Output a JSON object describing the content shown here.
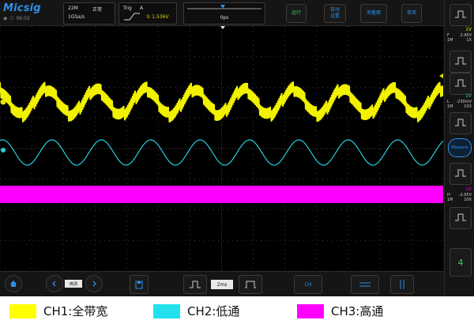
{
  "brand": "Micsig",
  "status": {
    "time": "06:02"
  },
  "acquisition": {
    "memory": "22M",
    "mode": "正常",
    "sample_rate": "1GSa/s"
  },
  "trigger": {
    "label": "Trig",
    "source": "A",
    "level": "1.536V"
  },
  "horizontal": {
    "position": "0ps"
  },
  "toolbar": {
    "run_label": "运行",
    "auto_label": "自动\n设置",
    "measure_label": "测量面",
    "menu_label": "菜单"
  },
  "channels": [
    {
      "id": "1",
      "name": "CH1",
      "color": "#e6e600",
      "scale": "1V",
      "coupling": "F",
      "offset": "2.95V",
      "impedance": "1M",
      "probe": "1X"
    },
    {
      "id": "2",
      "name": "CH2",
      "color": "#2fc6d3",
      "scale": "1V",
      "coupling": "L",
      "offset": "-230mV",
      "impedance": "1M",
      "probe": "10X"
    },
    {
      "id": "3",
      "name": "CH3",
      "color": "#e600e6",
      "scale": "1V",
      "coupling": "H",
      "offset": "-2.05V",
      "impedance": "1M",
      "probe": "10X"
    }
  ],
  "sidebar": {
    "measure_label": "Measure",
    "page_number": "4"
  },
  "bottom": {
    "fine_label": "微调",
    "timebase": "2ms",
    "ch_button": "CH"
  },
  "legend": [
    {
      "label": "CH1:全带宽",
      "color": "#ffff00"
    },
    {
      "label": "CH2:低通",
      "color": "#22e1ec"
    },
    {
      "label": "CH3:高通",
      "color": "#ff00ff"
    }
  ]
}
